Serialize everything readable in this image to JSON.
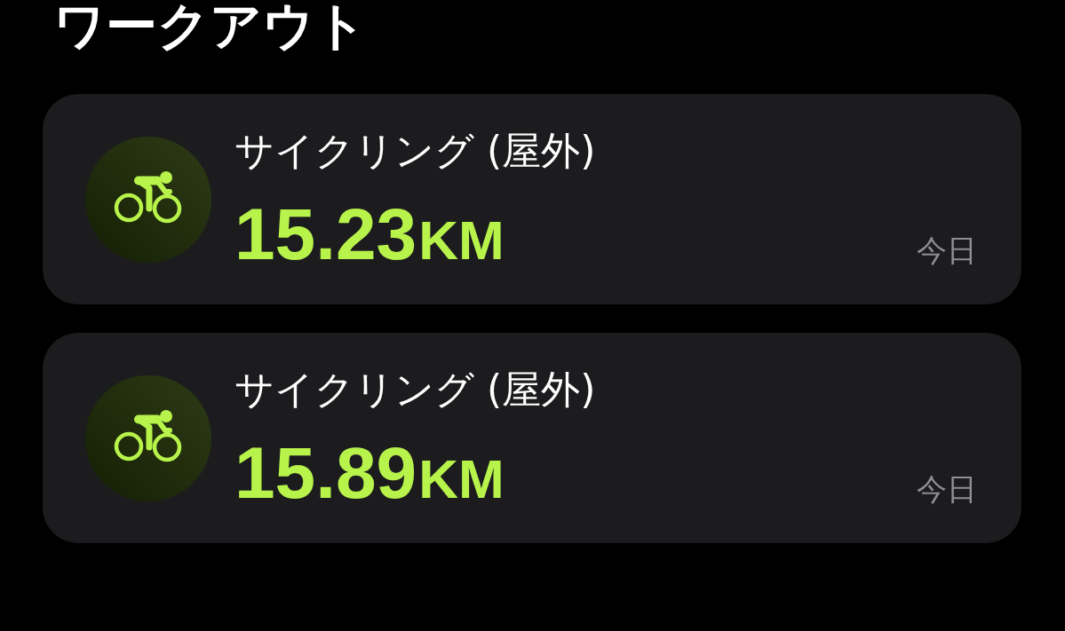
{
  "title": "ワークアウト",
  "workouts": [
    {
      "name": "サイクリング (屋外)",
      "distance": "15.23",
      "unit": "KM",
      "date": "今日"
    },
    {
      "name": "サイクリング (屋外)",
      "distance": "15.89",
      "unit": "KM",
      "date": "今日"
    }
  ]
}
